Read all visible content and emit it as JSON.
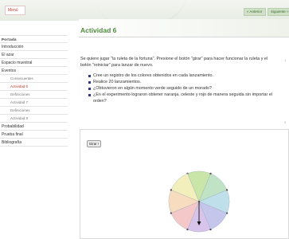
{
  "topbar": {
    "menu_label": "Menú",
    "prev_label": "« Anterior",
    "next_label": "Siguiente »"
  },
  "sidebar": {
    "items": [
      {
        "label": "Portada",
        "level": "top"
      },
      {
        "label": "Introducción",
        "level": "main"
      },
      {
        "label": "El azar",
        "level": "main"
      },
      {
        "label": "Espacio muestral",
        "level": "main"
      },
      {
        "label": "Eventos",
        "level": "main"
      },
      {
        "label": "Consecuentes",
        "level": "sub"
      },
      {
        "label": "Actividad 6",
        "level": "sub",
        "active": true
      },
      {
        "label": "Definiciones",
        "level": "sub"
      },
      {
        "label": "Actividad 7",
        "level": "sub"
      },
      {
        "label": "Definiciones",
        "level": "sub"
      },
      {
        "label": "Actividad 8",
        "level": "sub"
      },
      {
        "label": "Probabilidad",
        "level": "main"
      },
      {
        "label": "Prueba final",
        "level": "main"
      },
      {
        "label": "Bibliografía",
        "level": "main"
      }
    ]
  },
  "main": {
    "title": "Actividad 6",
    "intro_line1": "Se quiere jugar \"la ruleta de la fortuna\". Presione el botón \"girar\" para hacer funcionar la ruleta y el",
    "intro_line2": "botón \"reiniciar\" para lanzar de nuevo.",
    "bullets": [
      "Cree un registro de los colores obtenidos en cada lanzamiento.",
      "Realice 20 lanzamientos.",
      "¿Obtuvieron en algún momento verde seguido de un morado?",
      "¿En el experimento lograron obtener naranja, celeste y rojo de manera seguida sin importar el"
    ],
    "bullet_continuation": "orden?",
    "marker_a": "1",
    "marker_b": "5"
  },
  "applet": {
    "spin_label": "Girar !",
    "wheel_colors": [
      "#c9e6a8",
      "#bfe3c4",
      "#bfe0ea",
      "#c4c6ec",
      "#d8c4ea",
      "#f4c8c8",
      "#f8dcc0",
      "#f3efbd"
    ]
  }
}
